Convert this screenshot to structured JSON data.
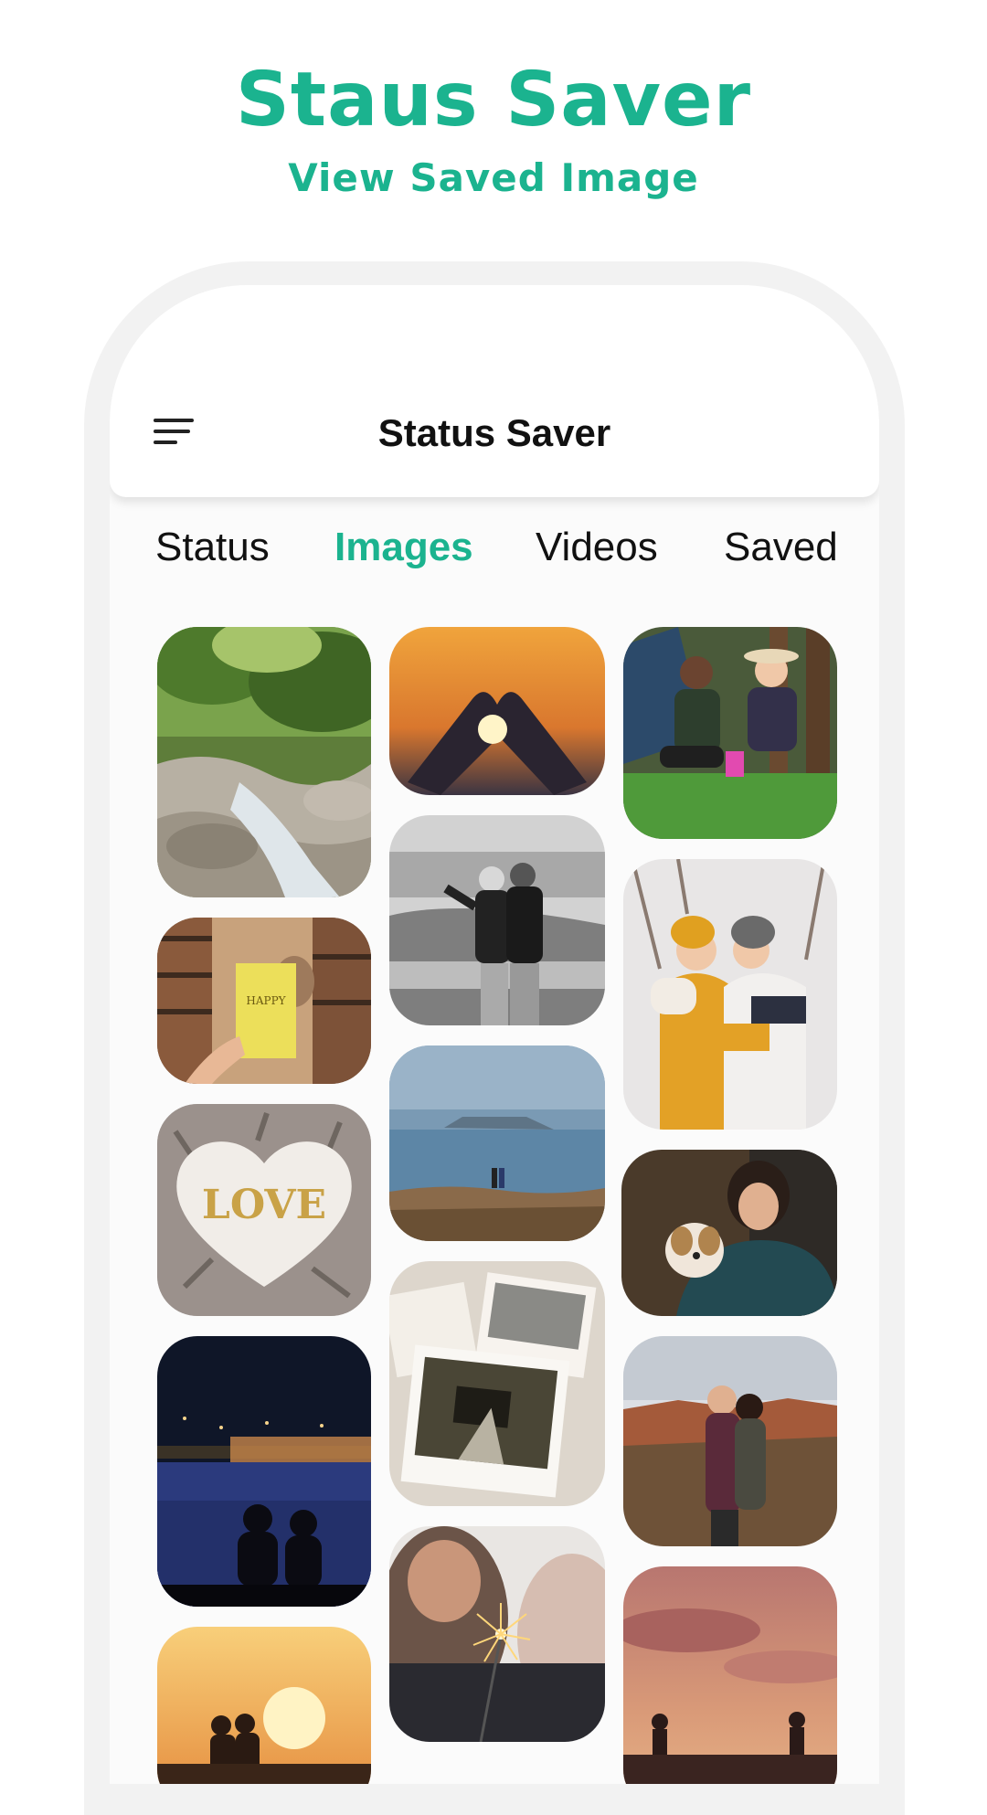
{
  "promo": {
    "title": "Staus Saver",
    "subtitle": "View Saved Image"
  },
  "app": {
    "title": "Status Saver",
    "accent_color": "#1bb38f"
  },
  "tabs": [
    {
      "label": "Status",
      "active": false
    },
    {
      "label": "Images",
      "active": true
    },
    {
      "label": "Videos",
      "active": false
    },
    {
      "label": "Saved",
      "active": false
    }
  ],
  "images": [
    {
      "subject": "forest stream with rocks"
    },
    {
      "subject": "hands heart shape at sunset"
    },
    {
      "subject": "couple picnic on grass"
    },
    {
      "subject": "hand holding HAPPY book in library"
    },
    {
      "subject": "black and white couple at coast"
    },
    {
      "subject": "couple hugging in snow"
    },
    {
      "subject": "LOVE heart on fur"
    },
    {
      "subject": "couple on cliff by the sea"
    },
    {
      "subject": "person hugging a small dog"
    },
    {
      "subject": "couple silhouette by lake at night"
    },
    {
      "subject": "scattered polaroid photos"
    },
    {
      "subject": "couple kissing in canyon"
    },
    {
      "subject": "couple sitting at sunset"
    },
    {
      "subject": "hand holding sparkler"
    },
    {
      "subject": "silhouettes under pink sky"
    }
  ]
}
